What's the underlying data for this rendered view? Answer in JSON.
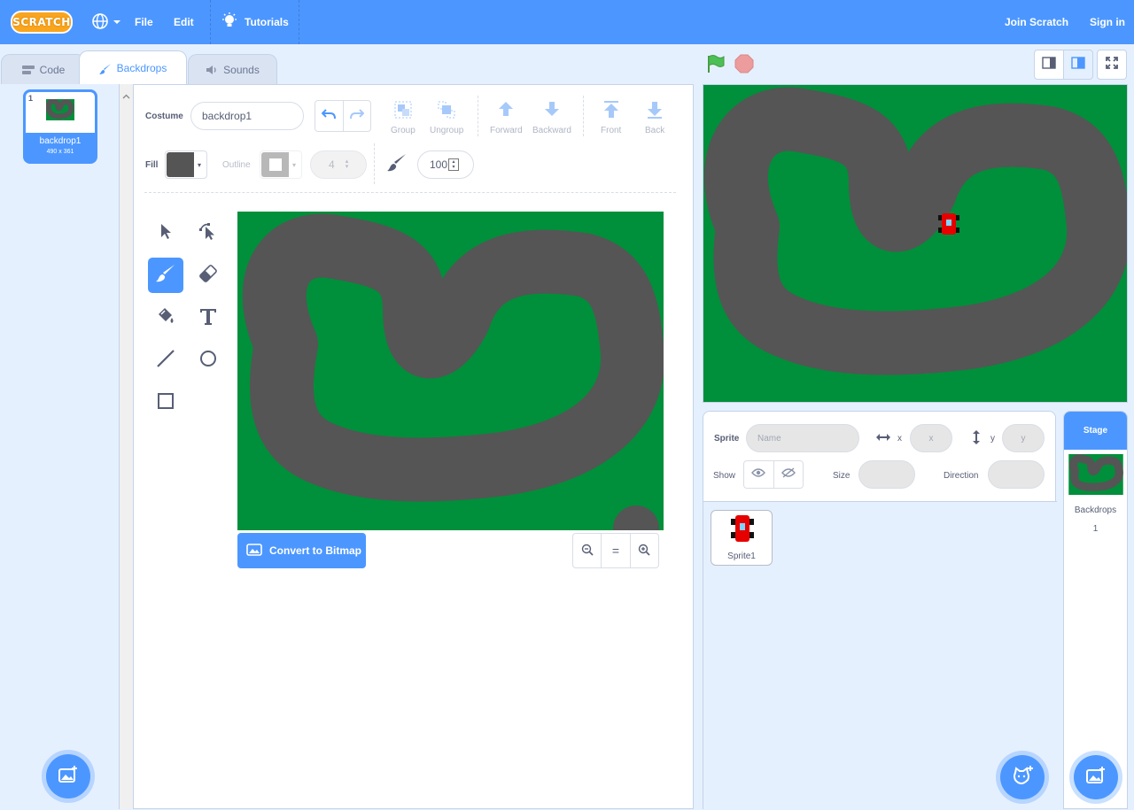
{
  "menubar": {
    "logo": "SCRATCH",
    "file": "File",
    "edit": "Edit",
    "tutorials": "Tutorials",
    "join": "Join Scratch",
    "signin": "Sign in"
  },
  "tabs": [
    {
      "label": "Code",
      "icon": "code-icon"
    },
    {
      "label": "Backdrops",
      "icon": "brush-icon"
    },
    {
      "label": "Sounds",
      "icon": "speaker-icon"
    }
  ],
  "costumes": [
    {
      "number": "1",
      "name": "backdrop1",
      "size": "490 x 361"
    }
  ],
  "editor": {
    "costume_label": "Costume",
    "costume_name": "backdrop1",
    "group": "Group",
    "ungroup": "Ungroup",
    "forward": "Forward",
    "backward": "Backward",
    "front": "Front",
    "back": "Back",
    "fill_label": "Fill",
    "outline_label": "Outline",
    "outline_width": "4",
    "brush_size": "100",
    "convert": "Convert to Bitmap",
    "zoom_reset": "="
  },
  "colors": {
    "accent": "#4c97ff",
    "grass": "#008f3a",
    "track": "#555555",
    "car": "#e60000"
  },
  "sprite_info": {
    "sprite_label": "Sprite",
    "name_placeholder": "Name",
    "x_label": "x",
    "x_placeholder": "x",
    "y_label": "y",
    "y_placeholder": "y",
    "show_label": "Show",
    "size_label": "Size",
    "direction_label": "Direction"
  },
  "sprites": [
    {
      "name": "Sprite1"
    }
  ],
  "stage_panel": {
    "title": "Stage",
    "backdrops_label": "Backdrops",
    "backdrops_count": "1"
  }
}
